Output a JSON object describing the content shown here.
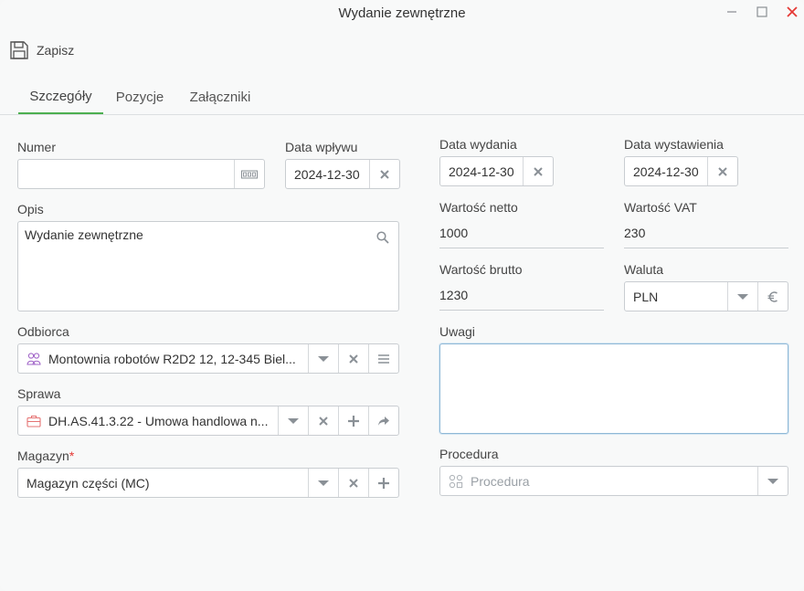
{
  "window": {
    "title": "Wydanie zewnętrzne"
  },
  "toolbar": {
    "save_label": "Zapisz"
  },
  "tabs": [
    {
      "label": "Szczegóły",
      "active": true
    },
    {
      "label": "Pozycje",
      "active": false
    },
    {
      "label": "Załączniki",
      "active": false
    }
  ],
  "form": {
    "numer": {
      "label": "Numer",
      "value": ""
    },
    "data_wplywu": {
      "label": "Data wpływu",
      "value": "2024-12-30"
    },
    "data_wydania": {
      "label": "Data wydania",
      "value": "2024-12-30"
    },
    "data_wystawienia": {
      "label": "Data wystawienia",
      "value": "2024-12-30"
    },
    "opis": {
      "label": "Opis",
      "value": "Wydanie zewnętrzne"
    },
    "wartosc_netto": {
      "label": "Wartość netto",
      "value": "1000"
    },
    "wartosc_vat": {
      "label": "Wartość VAT",
      "value": "230"
    },
    "wartosc_brutto": {
      "label": "Wartość brutto",
      "value": "1230"
    },
    "waluta": {
      "label": "Waluta",
      "value": "PLN"
    },
    "odbiorca": {
      "label": "Odbiorca",
      "value": "Montownia robotów R2D2 12, 12-345 Biel..."
    },
    "uwagi": {
      "label": "Uwagi",
      "value": ""
    },
    "sprawa": {
      "label": "Sprawa",
      "value": "DH.AS.41.3.22 - Umowa handlowa n..."
    },
    "magazyn": {
      "label": "Magazyn",
      "required_mark": "*",
      "value": "Magazyn części (MC)"
    },
    "procedura": {
      "label": "Procedura",
      "placeholder": "Procedura"
    }
  },
  "colors": {
    "accent": "#4caf50",
    "close": "#e53935",
    "required": "#e53935"
  }
}
